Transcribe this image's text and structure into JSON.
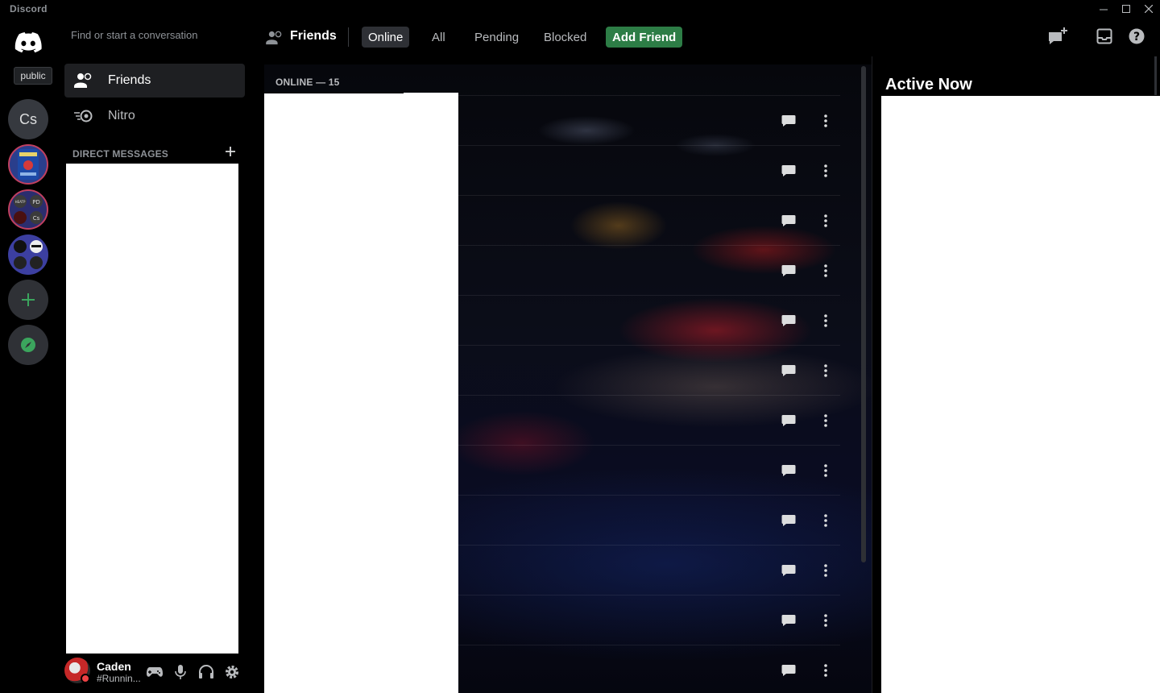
{
  "window": {
    "title": "Discord",
    "controls": [
      "minimize",
      "maximize",
      "close"
    ]
  },
  "servers": {
    "tooltip": "public",
    "items": [
      {
        "name": "discord-home",
        "icon": "discord-logo-icon"
      },
      {
        "name": "Cs",
        "initials": "Cs"
      },
      {
        "name": "server-alabama",
        "icon": "server-image"
      },
      {
        "name": "server-folder-1",
        "initials_small": [
          "HEATP",
          "PD",
          "",
          "Cs"
        ]
      },
      {
        "name": "server-folder-2",
        "icon": "server-folder"
      },
      {
        "name": "add-server",
        "icon": "plus-icon"
      },
      {
        "name": "explore",
        "icon": "compass-icon"
      }
    ]
  },
  "sidebar": {
    "search_placeholder": "Find or start a conversation",
    "nav": [
      {
        "label": "Friends",
        "icon": "friends-icon",
        "active": true
      },
      {
        "label": "Nitro",
        "icon": "nitro-icon",
        "active": false
      }
    ],
    "dm_header": "DIRECT MESSAGES"
  },
  "user": {
    "name": "Caden",
    "tag": "#Runnin...",
    "status": "dnd",
    "status_color": "#ed4245"
  },
  "header": {
    "title": "Friends",
    "tabs": [
      {
        "label": "Online",
        "active": true
      },
      {
        "label": "All",
        "active": false
      },
      {
        "label": "Pending",
        "active": false
      },
      {
        "label": "Blocked",
        "active": false
      }
    ],
    "add_friend": "Add Friend",
    "add_friend_color": "#2d7d46"
  },
  "friends": {
    "section_label": "ONLINE — 15",
    "row_actions": [
      "message-icon",
      "more-icon"
    ]
  },
  "active_now": {
    "title": "Active Now"
  }
}
